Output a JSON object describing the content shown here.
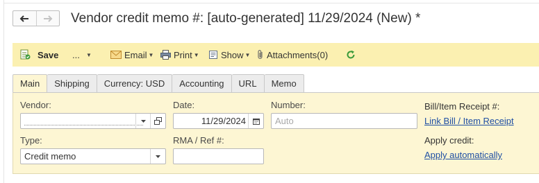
{
  "nav": {
    "back_icon": "arrow-left-icon",
    "forward_icon": "arrow-right-icon"
  },
  "title": "Vendor credit memo #: [auto-generated] 11/29/2024 (New) *",
  "toolbar": {
    "save_label": "Save",
    "more_label": "...",
    "email_label": "Email",
    "print_label": "Print",
    "show_label": "Show",
    "attachments_label": "Attachments(0)",
    "refresh_icon": "refresh-icon",
    "background_color": "#fbf0b1"
  },
  "tabs": [
    {
      "label": "Main",
      "active": true
    },
    {
      "label": "Shipping",
      "active": false
    },
    {
      "label": "Currency: USD",
      "active": false
    },
    {
      "label": "Accounting",
      "active": false
    },
    {
      "label": "URL",
      "active": false
    },
    {
      "label": "Memo",
      "active": false
    }
  ],
  "form": {
    "vendor": {
      "label": "Vendor:",
      "value": ""
    },
    "date": {
      "label": "Date:",
      "value": "11/29/2024"
    },
    "number": {
      "label": "Number:",
      "placeholder": "Auto"
    },
    "type": {
      "label": "Type:",
      "value": "Credit memo"
    },
    "rma": {
      "label": "RMA / Ref #:",
      "value": ""
    },
    "bill_receipt": {
      "label": "Bill/Item Receipt #:",
      "link": "Link Bill / Item Receipt"
    },
    "apply_credit": {
      "label": "Apply credit:",
      "link": "Apply automatically"
    },
    "panel_color": "#fdf6d3"
  }
}
